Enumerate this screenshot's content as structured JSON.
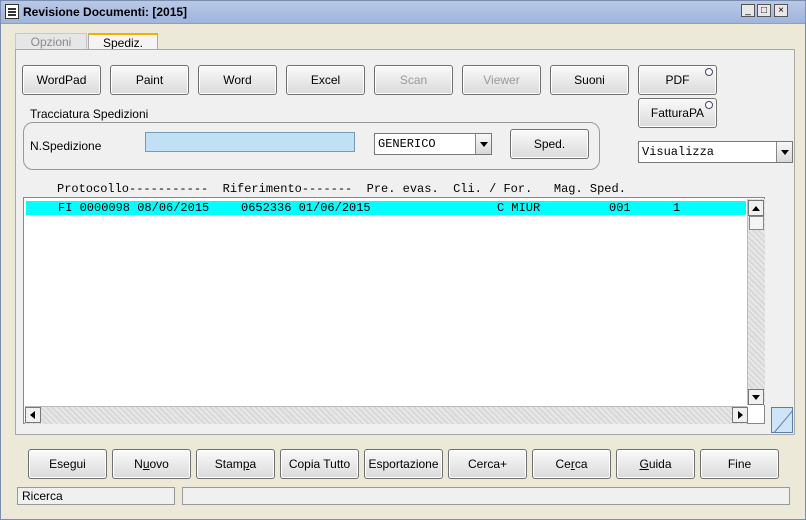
{
  "window": {
    "title": "Revisione Documenti: [2015]",
    "controls": {
      "minimize": "_",
      "maximize": "□",
      "close": "×"
    }
  },
  "tabs": [
    {
      "label": "Opzioni",
      "active": false
    },
    {
      "label": "Spediz.",
      "active": true
    }
  ],
  "toolbar": {
    "wordpad": "WordPad",
    "paint": "Paint",
    "word": "Word",
    "excel": "Excel",
    "scan": "Scan",
    "viewer": "Viewer",
    "suoni": "Suoni",
    "pdf": "PDF",
    "fatturapa": "FatturaPA"
  },
  "tracking": {
    "group_label": "Tracciatura Spedizioni",
    "field_label": "N.Spedizione",
    "field_value": "",
    "carrier_selected": "GENERICO",
    "sped_button": "Sped."
  },
  "view_select": {
    "selected": "Visualizza"
  },
  "list": {
    "header": "Protocollo-----------  Riferimento-------  Pre. evas.  Cli. / For.   Mag. Sped.",
    "rows": [
      {
        "protocollo": "FI 0000098 08/06/2015",
        "riferimento": "0652336 01/06/2015",
        "pre_evas": "",
        "cli_for": "C MIUR",
        "mag": "001",
        "sped": "1"
      }
    ]
  },
  "bottom_buttons": {
    "esegui": "Esegui",
    "nuovo_pre": "N",
    "nuovo_u": "u",
    "nuovo_post": "ovo",
    "stampa_pre": "Stam",
    "stampa_u": "p",
    "stampa_post": "a",
    "copia": "Copia Tutto",
    "esportazione": "Esportazione",
    "cercaplus": "Cerca+",
    "cerca_pre": "Ce",
    "cerca_u": "r",
    "cerca_post": "ca",
    "guida_pre": "",
    "guida_u": "G",
    "guida_post": "uida",
    "fine": "Fine"
  },
  "status": {
    "left": "Ricerca",
    "right": ""
  },
  "colors": {
    "selection": "#00ffff",
    "input_bg": "#bfe0f5",
    "tab_accent": "#f0b000"
  }
}
